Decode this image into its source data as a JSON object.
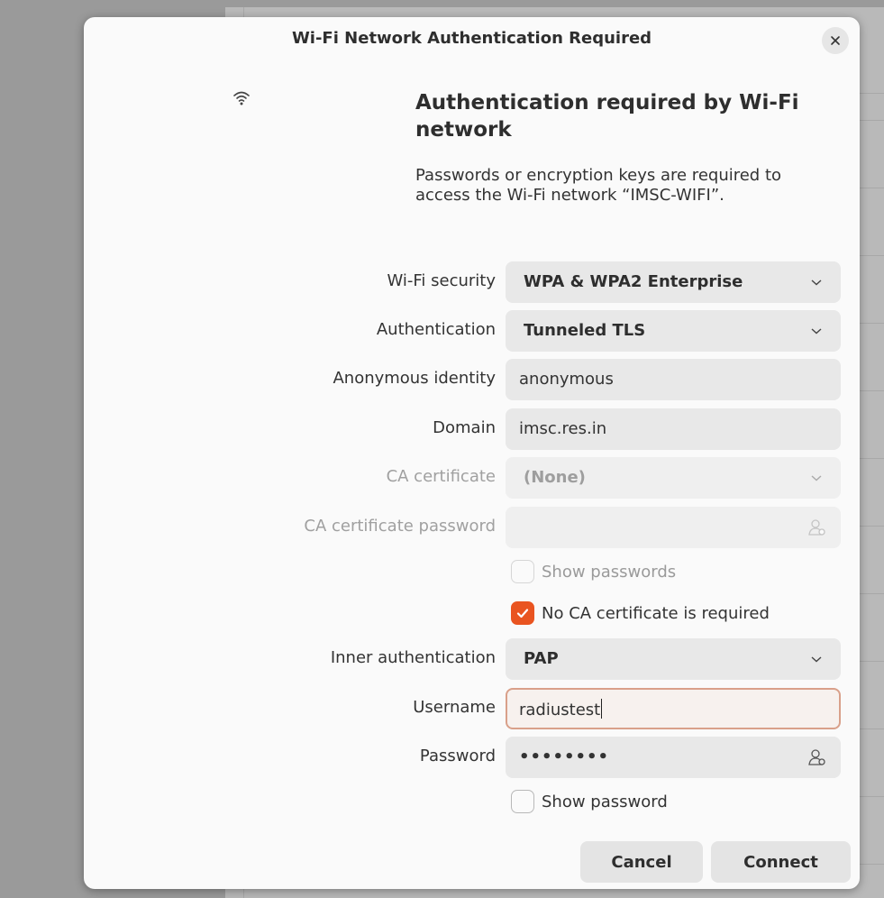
{
  "dialog": {
    "title": "Wi-Fi Network Authentication Required",
    "heading": "Authentication required by Wi-Fi network",
    "message": "Passwords or encryption keys are required to access the Wi-Fi network “IMSC-WIFI”."
  },
  "fields": {
    "wifi_security": {
      "label": "Wi-Fi security",
      "value": "WPA & WPA2 Enterprise"
    },
    "authentication": {
      "label": "Authentication",
      "value": "Tunneled TLS"
    },
    "anonymous_identity": {
      "label": "Anonymous identity",
      "value": "anonymous"
    },
    "domain": {
      "label": "Domain",
      "value": "imsc.res.in"
    },
    "ca_certificate": {
      "label": "CA certificate",
      "value": "(None)"
    },
    "ca_certificate_password": {
      "label": "CA certificate password",
      "value": ""
    },
    "show_passwords": {
      "label": "Show passwords",
      "checked": false
    },
    "no_ca_required": {
      "label": "No CA certificate is required",
      "checked": true
    },
    "inner_authentication": {
      "label": "Inner authentication",
      "value": "PAP"
    },
    "username": {
      "label": "Username",
      "value": "radiustest"
    },
    "password": {
      "label": "Password",
      "value": "••••••••"
    },
    "show_password": {
      "label": "Show password",
      "checked": false
    }
  },
  "buttons": {
    "cancel": "Cancel",
    "connect": "Connect"
  },
  "icons": {
    "close": "close-icon",
    "wifi": "wifi-icon",
    "dropdown": "chevron-down-icon",
    "password_storage": "user-key-icon"
  },
  "colors": {
    "accent": "#e95420",
    "focus_border": "#d9a08a"
  }
}
